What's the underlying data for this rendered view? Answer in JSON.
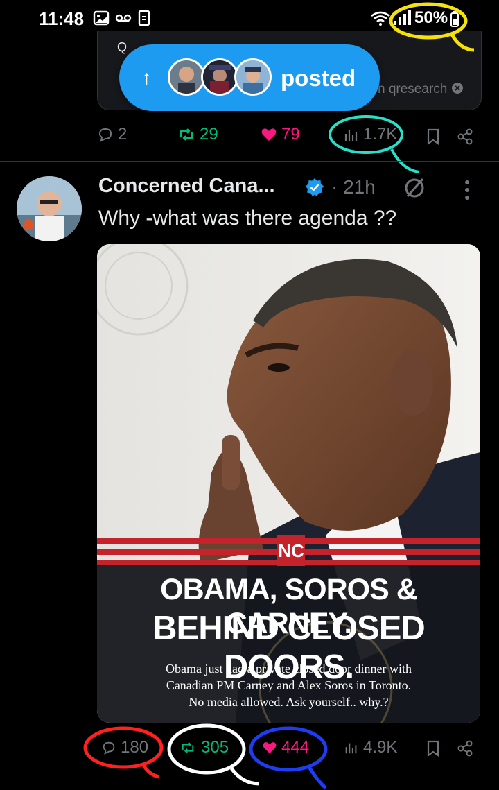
{
  "status_bar": {
    "time": "11:48",
    "battery": "50%"
  },
  "quoted_tweet": {
    "search_char": "Q",
    "search_tag": "n qresearch"
  },
  "posted_pill": {
    "label": "posted"
  },
  "prev_actions": {
    "replies": "2",
    "reposts": "29",
    "likes": "79",
    "views": "1.7K"
  },
  "tweet": {
    "author": "Concerned Cana...",
    "time": "· 21h",
    "text": "Why -what was there agenda ??",
    "media": {
      "badge": "NC",
      "headline_1": "OBAMA, SOROS & CARNEY.",
      "headline_2": "BEHIND CLOSED DOORS.",
      "caption_1": "Obama just had a private closed door dinner with",
      "caption_2": "Canadian PM Carney and Alex Soros in Toronto.",
      "caption_3": "No media allowed. Ask yourself.. why.?"
    },
    "actions": {
      "replies": "180",
      "reposts": "305",
      "likes": "444",
      "views": "4.9K"
    }
  },
  "colors": {
    "accent": "#1d9bf0",
    "repost": "#00ba7c",
    "like": "#f91880",
    "muted": "#71767b"
  }
}
